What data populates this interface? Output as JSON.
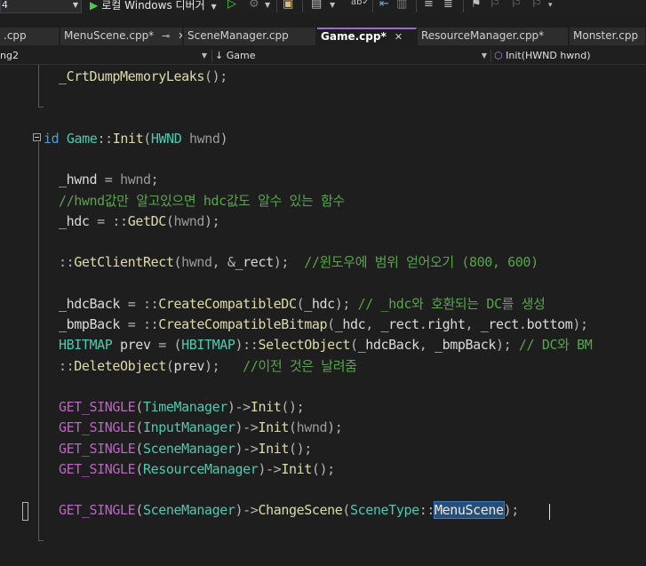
{
  "toolbar": {
    "config_value": "4",
    "debug_label": "로컬 Windows 디버거",
    "icons": [
      "play-icon",
      "attach-process-icon",
      "solution-explorer-icon",
      "layout-icon",
      "spell-check-icon",
      "step-icon",
      "format-icon",
      "comment-icon",
      "bookmark-icon"
    ]
  },
  "tabs": [
    {
      "label": ".cpp",
      "active": false
    },
    {
      "label": "MenuScene.cpp*",
      "active": false,
      "pinned": true
    },
    {
      "label": "SceneManager.cpp",
      "active": false
    },
    {
      "label": "Game.cpp*",
      "active": true
    },
    {
      "label": "ResourceManager.cpp*",
      "active": false
    },
    {
      "label": "Monster.cpp",
      "active": false
    }
  ],
  "navbar": {
    "project": "ng2",
    "scope": "↓ Game",
    "member": "Init(HWND hwnd)"
  },
  "code": {
    "lines": [
      [
        [
          "t-fn",
          "_CrtDumpMemoryLeaks"
        ],
        [
          "t-op",
          "();"
        ]
      ],
      [],
      [],
      [
        [
          "t-kw",
          "id "
        ],
        [
          "t-ty",
          "Game"
        ],
        [
          "t-op",
          "::"
        ],
        [
          "t-fn",
          "Init"
        ],
        [
          "t-op",
          "("
        ],
        [
          "t-ty",
          "HWND "
        ],
        [
          "t-pa",
          "hwnd"
        ],
        [
          "t-op",
          ")"
        ]
      ],
      [],
      [
        [
          "t-id",
          "_hwnd "
        ],
        [
          "t-op",
          "= "
        ],
        [
          "t-pa",
          "hwnd"
        ],
        [
          "t-op",
          ";"
        ]
      ],
      [
        [
          "t-cm",
          "//hwnd값만 알고있으면 hdc값도 알수 있는 함수"
        ]
      ],
      [
        [
          "t-id",
          "_hdc "
        ],
        [
          "t-op",
          "= ::"
        ],
        [
          "t-fn",
          "GetDC"
        ],
        [
          "t-op",
          "("
        ],
        [
          "t-pa",
          "hwnd"
        ],
        [
          "t-op",
          ");"
        ]
      ],
      [],
      [
        [
          "t-op",
          "::"
        ],
        [
          "t-fn",
          "GetClientRect"
        ],
        [
          "t-op",
          "("
        ],
        [
          "t-pa",
          "hwnd"
        ],
        [
          "t-op",
          ", &"
        ],
        [
          "t-id",
          "_rect"
        ],
        [
          "t-op",
          ");  "
        ],
        [
          "t-cm",
          "//윈도우에 범위 얻어오기 (800, 600)"
        ]
      ],
      [],
      [
        [
          "t-id",
          "_hdcBack "
        ],
        [
          "t-op",
          "= ::"
        ],
        [
          "t-fn",
          "CreateCompatibleDC"
        ],
        [
          "t-op",
          "("
        ],
        [
          "t-id",
          "_hdc"
        ],
        [
          "t-op",
          "); "
        ],
        [
          "t-cm",
          "// _hdc와 호환되는 DC를 생성"
        ]
      ],
      [
        [
          "t-id",
          "_bmpBack "
        ],
        [
          "t-op",
          "= ::"
        ],
        [
          "t-fn",
          "CreateCompatibleBitmap"
        ],
        [
          "t-op",
          "("
        ],
        [
          "t-id",
          "_hdc"
        ],
        [
          "t-op",
          ", "
        ],
        [
          "t-id",
          "_rect"
        ],
        [
          "t-op",
          "."
        ],
        [
          "t-id",
          "right"
        ],
        [
          "t-op",
          ", "
        ],
        [
          "t-id",
          "_rect"
        ],
        [
          "t-op",
          "."
        ],
        [
          "t-id",
          "bottom"
        ],
        [
          "t-op",
          ");"
        ]
      ],
      [
        [
          "t-ty",
          "HBITMAP "
        ],
        [
          "t-id",
          "prev "
        ],
        [
          "t-op",
          "= ("
        ],
        [
          "t-ty",
          "HBITMAP"
        ],
        [
          "t-op",
          ")::"
        ],
        [
          "t-fn",
          "SelectObject"
        ],
        [
          "t-op",
          "("
        ],
        [
          "t-id",
          "_hdcBack"
        ],
        [
          "t-op",
          ", "
        ],
        [
          "t-id",
          "_bmpBack"
        ],
        [
          "t-op",
          "); "
        ],
        [
          "t-cm",
          "// DC와 BM"
        ]
      ],
      [
        [
          "t-op",
          "::"
        ],
        [
          "t-fn",
          "DeleteObject"
        ],
        [
          "t-op",
          "("
        ],
        [
          "t-id",
          "prev"
        ],
        [
          "t-op",
          ");   "
        ],
        [
          "t-cm",
          "//이전 것은 날려줌"
        ]
      ],
      [],
      [
        [
          "t-gl",
          "GET_SINGLE"
        ],
        [
          "t-op",
          "("
        ],
        [
          "t-ty",
          "TimeManager"
        ],
        [
          "t-op",
          ")->"
        ],
        [
          "t-fn",
          "Init"
        ],
        [
          "t-op",
          "();"
        ]
      ],
      [
        [
          "t-gl",
          "GET_SINGLE"
        ],
        [
          "t-op",
          "("
        ],
        [
          "t-ty",
          "InputManager"
        ],
        [
          "t-op",
          ")->"
        ],
        [
          "t-fn",
          "Init"
        ],
        [
          "t-op",
          "("
        ],
        [
          "t-pa",
          "hwnd"
        ],
        [
          "t-op",
          ");"
        ]
      ],
      [
        [
          "t-gl",
          "GET_SINGLE"
        ],
        [
          "t-op",
          "("
        ],
        [
          "t-ty",
          "SceneManager"
        ],
        [
          "t-op",
          ")->"
        ],
        [
          "t-fn",
          "Init"
        ],
        [
          "t-op",
          "();"
        ]
      ],
      [
        [
          "t-gl",
          "GET_SINGLE"
        ],
        [
          "t-op",
          "("
        ],
        [
          "t-ty",
          "ResourceManager"
        ],
        [
          "t-op",
          ")->"
        ],
        [
          "t-fn",
          "Init"
        ],
        [
          "t-op",
          "();"
        ]
      ],
      [],
      [
        [
          "t-gl",
          "GET_SINGLE"
        ],
        [
          "t-op",
          "("
        ],
        [
          "t-ty",
          "SceneManager"
        ],
        [
          "t-op",
          ")->"
        ],
        [
          "t-fn",
          "ChangeScene"
        ],
        [
          "t-op",
          "("
        ],
        [
          "t-ty",
          "SceneType"
        ],
        [
          "t-op",
          "::"
        ],
        [
          "t-sel",
          "MenuScene"
        ],
        [
          "t-op",
          ");"
        ]
      ]
    ]
  }
}
